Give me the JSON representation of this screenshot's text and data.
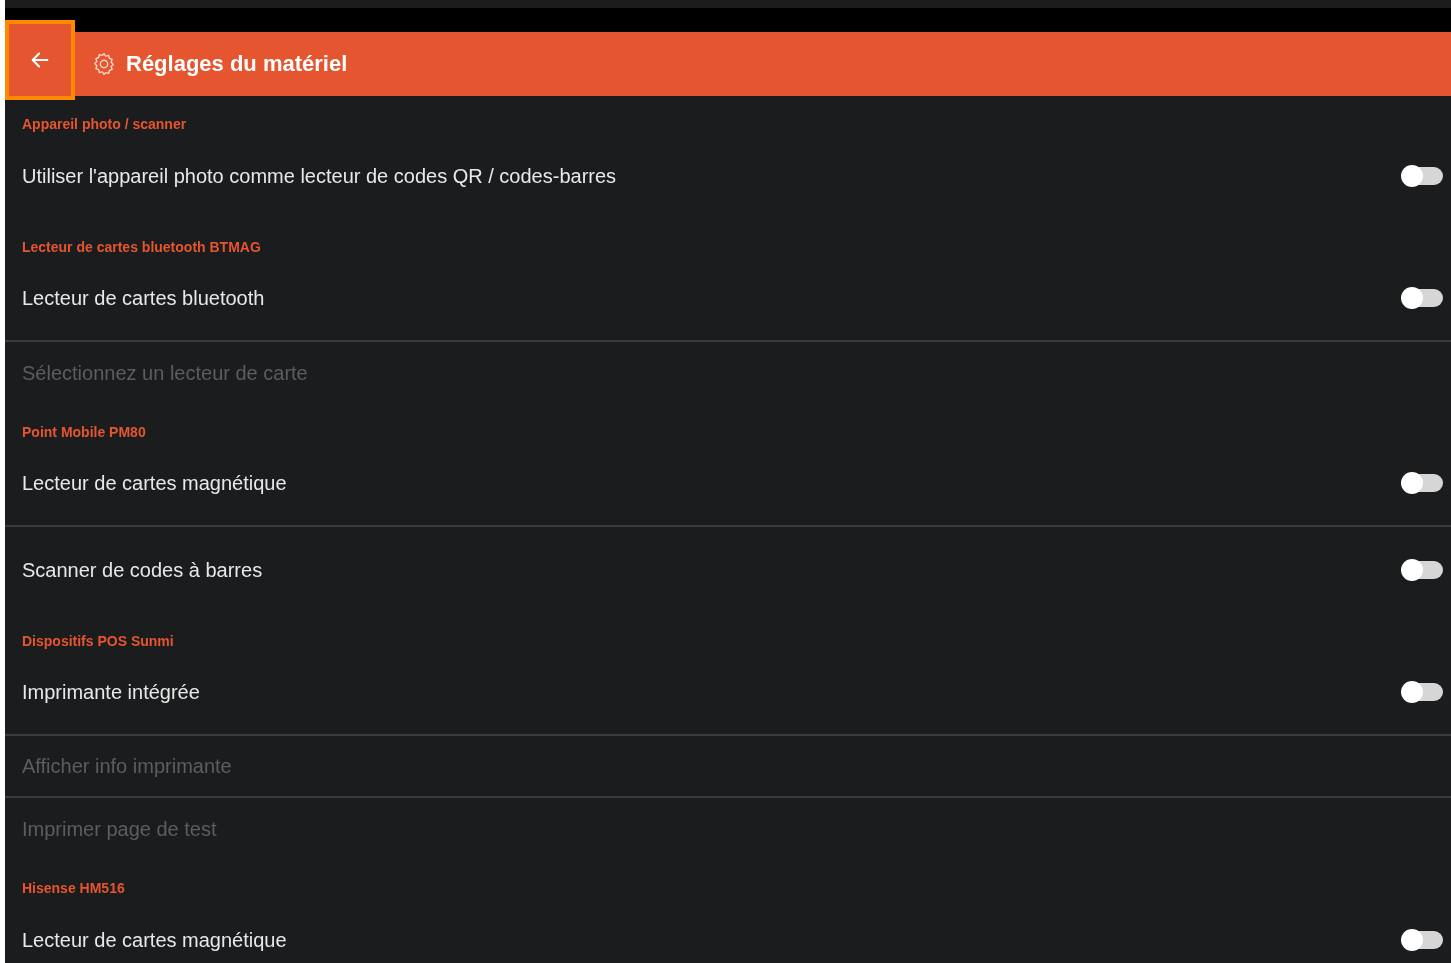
{
  "header": {
    "title": "Réglages du matériel"
  },
  "items": [
    {
      "kind": "section",
      "text": "Appareil photo / scanner"
    },
    {
      "kind": "toggle",
      "text": "Utiliser l'appareil photo comme lecteur de codes QR / codes-barres",
      "on": false,
      "divider_after": false
    },
    {
      "kind": "section",
      "text": "Lecteur de cartes bluetooth BTMAG"
    },
    {
      "kind": "toggle",
      "text": "Lecteur de cartes bluetooth",
      "on": false,
      "divider_after": true
    },
    {
      "kind": "action",
      "text": "Sélectionnez un lecteur de carte",
      "disabled": true,
      "divider_after": false
    },
    {
      "kind": "section",
      "text": "Point Mobile PM80"
    },
    {
      "kind": "toggle",
      "text": "Lecteur de cartes magnétique",
      "on": false,
      "divider_after": true
    },
    {
      "kind": "toggle",
      "text": "Scanner de codes à barres",
      "on": false,
      "divider_after": false
    },
    {
      "kind": "section",
      "text": "Dispositifs POS Sunmi"
    },
    {
      "kind": "toggle",
      "text": "Imprimante intégrée",
      "on": false,
      "divider_after": true
    },
    {
      "kind": "action",
      "text": "Afficher info imprimante",
      "disabled": true,
      "divider_after": true
    },
    {
      "kind": "action",
      "text": "Imprimer page de test",
      "disabled": true,
      "divider_after": false
    },
    {
      "kind": "section",
      "text": "Hisense HM516"
    },
    {
      "kind": "toggle",
      "text": "Lecteur de cartes magnétique",
      "on": false,
      "divider_after": false
    }
  ]
}
